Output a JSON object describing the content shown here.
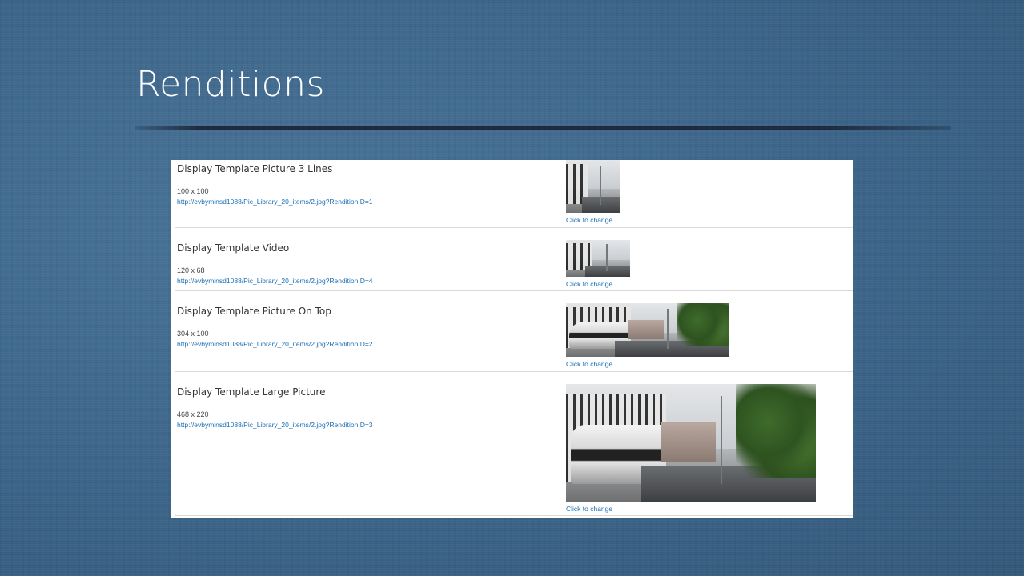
{
  "slide": {
    "title": "Renditions"
  },
  "renditions": [
    {
      "name": "Display Template Picture 3 Lines",
      "size": "100 x 100",
      "url": "http://evbyminsd1088/Pic_Library_20_items/2.jpg?RenditionID=1",
      "change_label": "Click to change"
    },
    {
      "name": "Display Template Video",
      "size": "120 x 68",
      "url": "http://evbyminsd1088/Pic_Library_20_items/2.jpg?RenditionID=4",
      "change_label": "Click to change"
    },
    {
      "name": "Display Template Picture On Top",
      "size": "304 x 100",
      "url": "http://evbyminsd1088/Pic_Library_20_items/2.jpg?RenditionID=2",
      "change_label": "Click to change"
    },
    {
      "name": "Display Template Large Picture",
      "size": "468 x 220",
      "url": "http://evbyminsd1088/Pic_Library_20_items/2.jpg?RenditionID=3",
      "change_label": "Click to change"
    }
  ]
}
